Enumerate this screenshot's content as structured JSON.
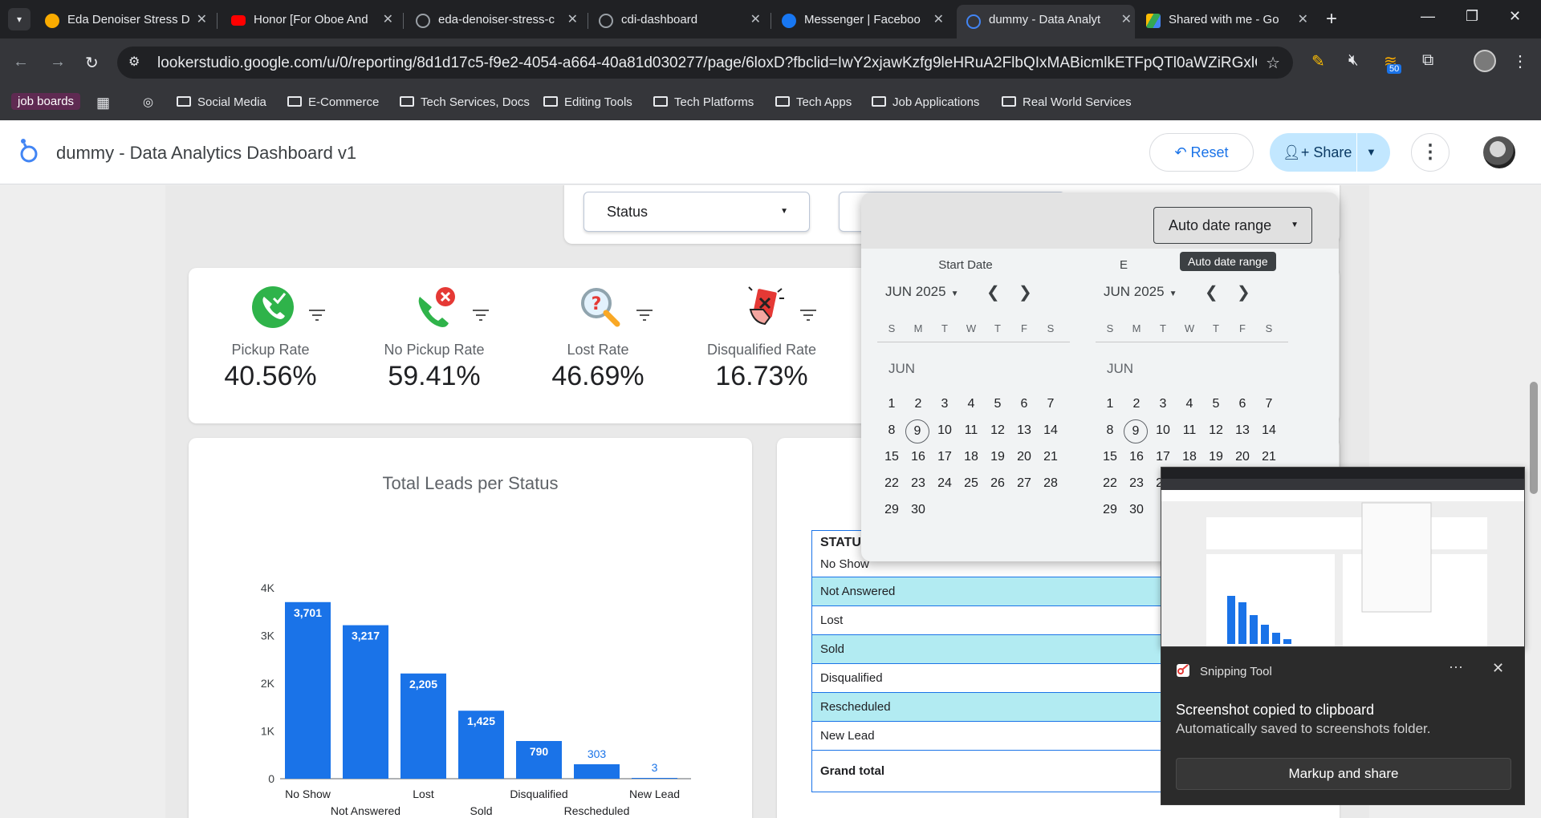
{
  "browser": {
    "tabs": [
      {
        "title": "Eda Denoiser Stress D",
        "active": false,
        "favicon_color": "#f9ab00"
      },
      {
        "title": "Honor [For Oboe And",
        "active": false,
        "favicon_color": "#ff0000"
      },
      {
        "title": "eda-denoiser-stress-c",
        "active": false,
        "favicon_color": "#9aa0a6"
      },
      {
        "title": "cdi-dashboard",
        "active": false,
        "favicon_color": "#9aa0a6"
      },
      {
        "title": "Messenger | Faceboo",
        "active": false,
        "favicon_color": "#1877f2"
      },
      {
        "title": "dummy - Data Analyt",
        "active": true,
        "favicon_color": "#4285f4"
      },
      {
        "title": "Shared with me - Go",
        "active": false,
        "favicon_color": "#34a853"
      }
    ],
    "new_tab_icon": "+",
    "url": "lookerstudio.google.com/u/0/reporting/8d1d17c5-f9e2-4054-a664-40a81d030277/page/6loxD?fbclid=IwY2xjawKzfg9leHRuA2FlbQIxMABicmlkETFpQTl0aWZiRGxlQUJna3NwA...",
    "extension_badge": "50",
    "bookmarks": {
      "pill": "job boards",
      "folders": [
        "Social Media",
        "E-Commerce",
        "Tech Services, Docs",
        "Editing Tools",
        "Tech Platforms",
        "Tech Apps",
        "Job Applications",
        "Real World Services"
      ]
    }
  },
  "app": {
    "title": "dummy - Data Analytics Dashboard v1",
    "reset_label": "Reset",
    "share_label": "Share"
  },
  "filters": {
    "status_label": "Status"
  },
  "kpis": [
    {
      "name": "Pickup Rate",
      "value": "40.56%",
      "icon": "phone-check-icon"
    },
    {
      "name": "No Pickup Rate",
      "value": "59.41%",
      "icon": "phone-x-icon"
    },
    {
      "name": "Lost Rate",
      "value": "46.69%",
      "icon": "magnifier-question-icon"
    },
    {
      "name": "Disqualified Rate",
      "value": "16.73%",
      "icon": "disqualified-card-icon"
    }
  ],
  "chart_data": {
    "type": "bar",
    "title": "Total Leads per Status",
    "categories": [
      "No Show",
      "Not Answered",
      "Lost",
      "Sold",
      "Disqualified",
      "Rescheduled",
      "New Lead"
    ],
    "values": [
      3701,
      3217,
      2205,
      1425,
      790,
      303,
      3
    ],
    "value_labels": [
      "3,701",
      "3,217",
      "2,205",
      "1,425",
      "790",
      "303",
      "3"
    ],
    "y_ticks": [
      "0",
      "1K",
      "2K",
      "3K",
      "4K"
    ],
    "ylim": [
      0,
      4000
    ],
    "bar_color": "#1a73e8",
    "grid": false
  },
  "table": {
    "header": "STATU",
    "rows": [
      "No Show",
      "Not Answered",
      "Lost",
      "Sold",
      "Disqualified",
      "Rescheduled",
      "New Lead"
    ],
    "total_label": "Grand total"
  },
  "datepicker": {
    "range_label": "Auto date range",
    "tooltip": "Auto date range",
    "start_label": "Start Date",
    "end_label_partial": "E",
    "month": "JUN 2025",
    "month_short": "JUN",
    "weekdays": [
      "S",
      "M",
      "T",
      "W",
      "T",
      "F",
      "S"
    ],
    "days": [
      "1",
      "2",
      "3",
      "4",
      "5",
      "6",
      "7",
      "8",
      "9",
      "10",
      "11",
      "12",
      "13",
      "14",
      "15",
      "16",
      "17",
      "18",
      "19",
      "20",
      "21",
      "22",
      "23",
      "24",
      "25",
      "26",
      "27",
      "28",
      "29",
      "30"
    ],
    "today": "9"
  },
  "notification": {
    "app": "Snipping Tool",
    "message": "Screenshot copied to clipboard",
    "sub": "Automatically saved to screenshots folder.",
    "button": "Markup and share"
  }
}
